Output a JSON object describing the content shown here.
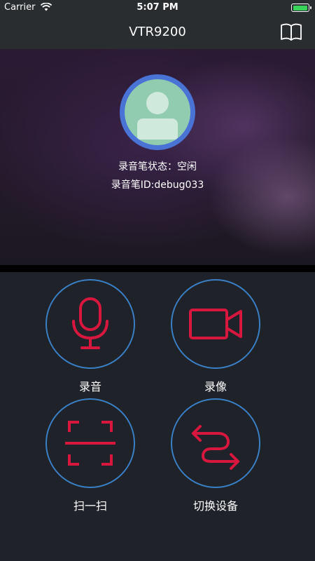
{
  "status_bar": {
    "carrier": "Carrier",
    "time": "5:07 PM",
    "battery_level": 1.0
  },
  "nav": {
    "title": "VTR9200",
    "right_icon": "book-icon"
  },
  "device": {
    "status_text": "录音笔状态：空闲",
    "id_text": "录音笔ID:debug033",
    "avatar_icon": "user-avatar-icon"
  },
  "actions": [
    {
      "label": "录音",
      "icon": "microphone-icon"
    },
    {
      "label": "录像",
      "icon": "video-camera-icon"
    },
    {
      "label": "扫一扫",
      "icon": "scan-icon"
    },
    {
      "label": "切换设备",
      "icon": "switch-device-icon"
    }
  ],
  "colors": {
    "accent_red": "#d8173f",
    "ring_blue": "#3a7fc6",
    "avatar_ring": "#4a73d6",
    "avatar_fill": "#91cbb0",
    "battery_green": "#37d35a"
  }
}
